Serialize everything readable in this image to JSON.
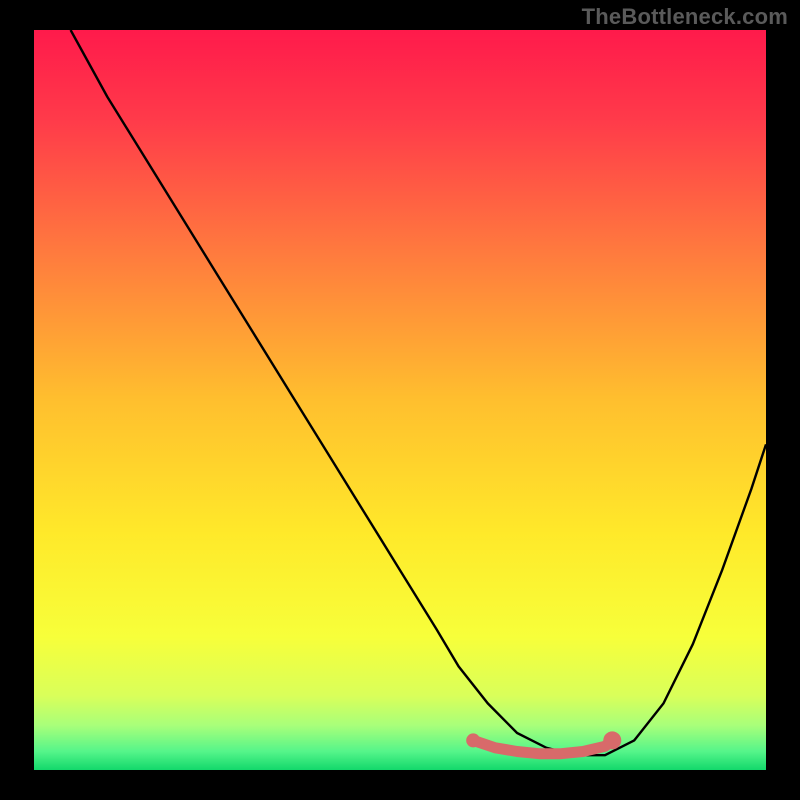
{
  "attribution": "TheBottleneck.com",
  "chart_data": {
    "type": "line",
    "title": "",
    "xlabel": "",
    "ylabel": "",
    "xlim": [
      0,
      100
    ],
    "ylim": [
      0,
      100
    ],
    "series": [
      {
        "name": "curve",
        "x": [
          5,
          10,
          15,
          20,
          25,
          30,
          35,
          40,
          45,
          50,
          55,
          58,
          62,
          66,
          70,
          74,
          78,
          82,
          86,
          90,
          94,
          98,
          100
        ],
        "values": [
          100,
          91,
          83,
          75,
          67,
          59,
          51,
          43,
          35,
          27,
          19,
          14,
          9,
          5,
          3,
          2,
          2,
          4,
          9,
          17,
          27,
          38,
          44
        ]
      },
      {
        "name": "highlight",
        "x": [
          60,
          63,
          66,
          69,
          72,
          75,
          78,
          79
        ],
        "values": [
          4.0,
          3.0,
          2.5,
          2.2,
          2.2,
          2.5,
          3.2,
          4.0
        ]
      }
    ],
    "gradient_stops": [
      {
        "offset": 0.0,
        "color": "#ff1a4b"
      },
      {
        "offset": 0.12,
        "color": "#ff3a4a"
      },
      {
        "offset": 0.3,
        "color": "#ff7a3e"
      },
      {
        "offset": 0.5,
        "color": "#ffbf2e"
      },
      {
        "offset": 0.68,
        "color": "#ffe92a"
      },
      {
        "offset": 0.82,
        "color": "#f7ff3a"
      },
      {
        "offset": 0.9,
        "color": "#d9ff5a"
      },
      {
        "offset": 0.94,
        "color": "#a8ff7a"
      },
      {
        "offset": 0.975,
        "color": "#55f58a"
      },
      {
        "offset": 1.0,
        "color": "#12d86b"
      }
    ]
  }
}
